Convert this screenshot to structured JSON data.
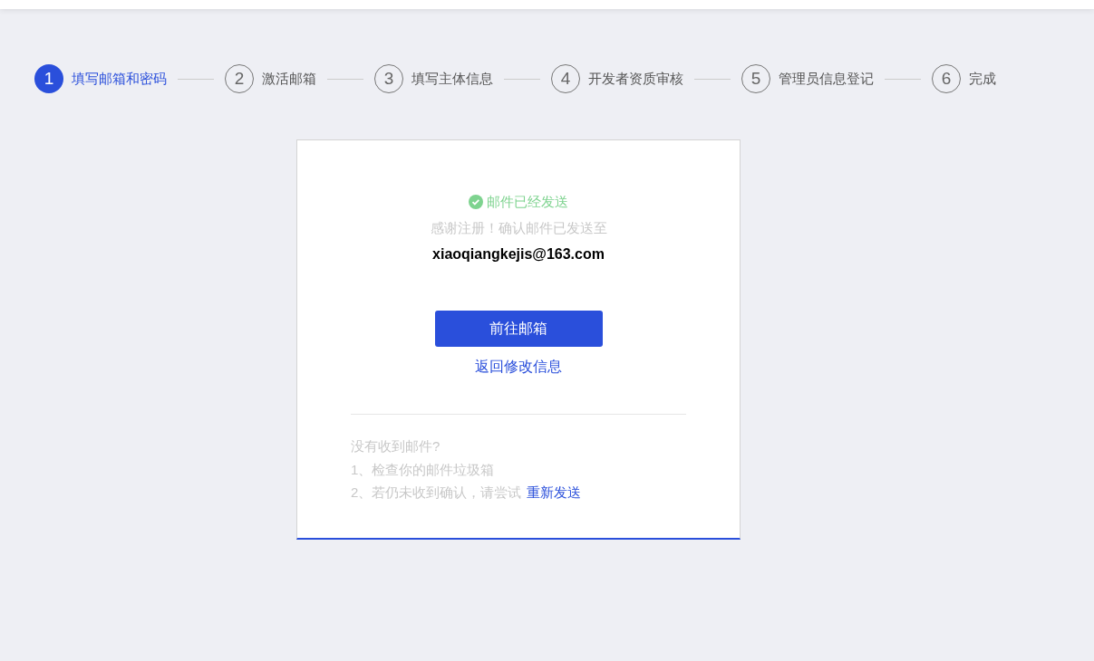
{
  "steps": [
    {
      "number": "1",
      "label": "填写邮箱和密码",
      "selected": true
    },
    {
      "number": "2",
      "label": "激活邮箱",
      "selected": false
    },
    {
      "number": "3",
      "label": "填写主体信息",
      "selected": false
    },
    {
      "number": "4",
      "label": "开发者资质审核",
      "selected": false
    },
    {
      "number": "5",
      "label": "管理员信息登记",
      "selected": false
    },
    {
      "number": "6",
      "label": "完成",
      "selected": false
    }
  ],
  "card": {
    "status": "邮件已经发送",
    "message": "感谢注册！确认邮件已发送至",
    "email": "xiaoqiangkejis@163.com",
    "primary_button": "前往邮箱",
    "back_link": "返回修改信息",
    "help": {
      "title": "没有收到邮件?",
      "lines": [
        {
          "text": "1、检查你的邮件垃圾箱"
        },
        {
          "text": "2、若仍未收到确认，请尝试",
          "link": "重新发送"
        }
      ]
    }
  }
}
